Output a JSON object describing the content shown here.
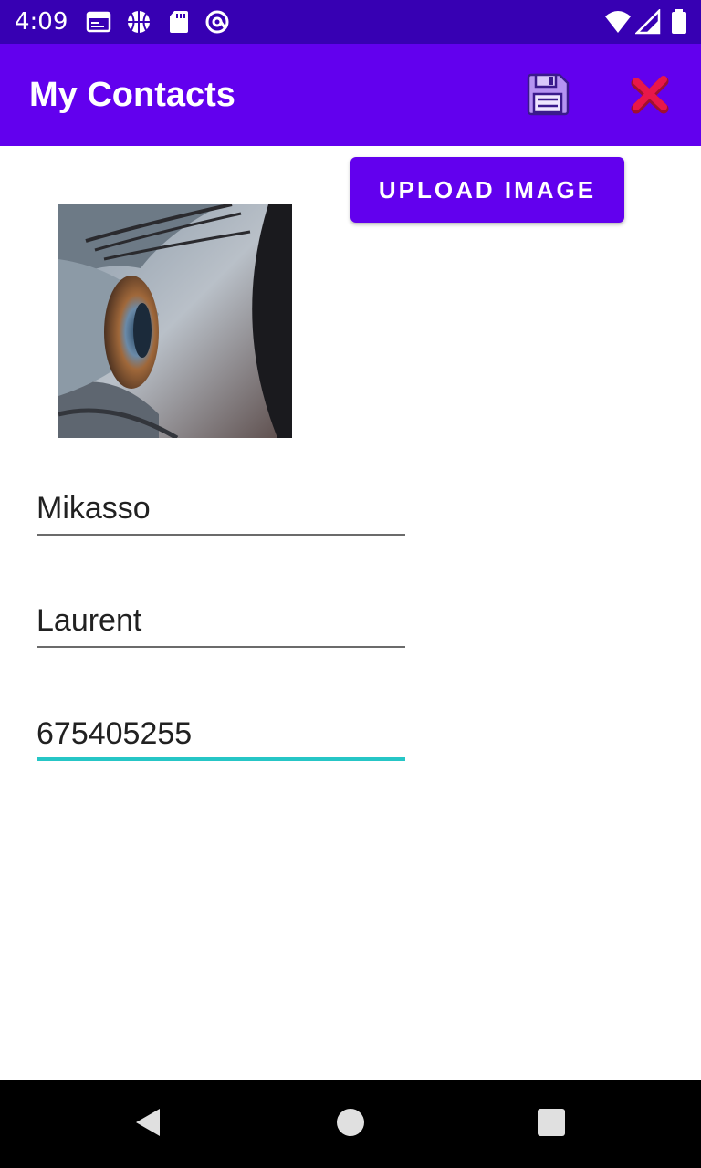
{
  "status_bar": {
    "time": "4:09",
    "icons": [
      "calendar-icon",
      "basketball-icon",
      "sd-card-icon",
      "at-sign-icon",
      "wifi-icon",
      "signal-icon",
      "battery-icon"
    ]
  },
  "app_bar": {
    "title": "My Contacts",
    "actions": [
      "save-icon",
      "close-icon"
    ]
  },
  "upload": {
    "label": "UPLOAD IMAGE"
  },
  "form": {
    "first_name": "Mikasso",
    "last_name": "Laurent",
    "phone": "675405255"
  },
  "colors": {
    "status_bar": "#3700b3",
    "app_bar": "#6200ee",
    "accent_focus": "#26c6c6",
    "close_icon": "#e8174a"
  }
}
